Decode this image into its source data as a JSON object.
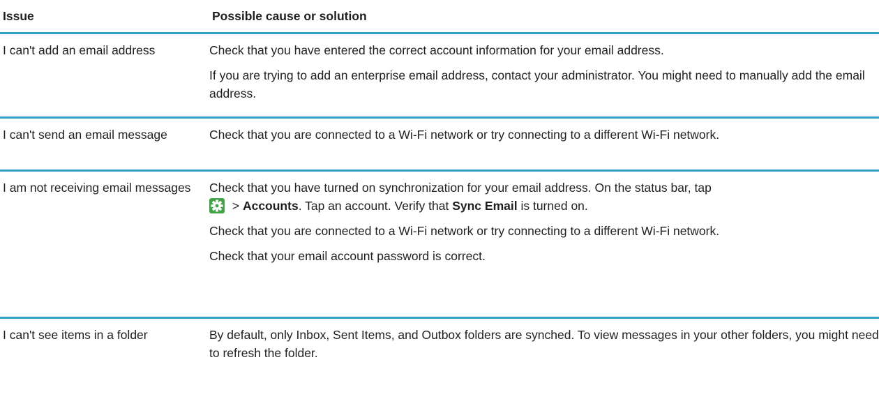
{
  "header": {
    "issue": "Issue",
    "cause": "Possible cause or solution"
  },
  "rows": [
    {
      "issue": "I can't add an email address",
      "solutions": [
        "Check that you have entered the correct account information for your email address.",
        "If you are trying to add an enterprise email address, contact your administrator. You might need to manually add the email address."
      ]
    },
    {
      "issue": "I can't send an email message",
      "solutions": [
        "Check that you are connected to a Wi-Fi network or try connecting to a different Wi-Fi network."
      ]
    },
    {
      "issue": "I am not receiving email messages",
      "solutions": [
        {
          "intro": "Check that you have turned on synchronization for your email address. On the status bar, tap",
          "sep": " > ",
          "accounts": "Accounts",
          "mid": ". Tap an account. Verify that ",
          "sync": "Sync Email",
          "end": " is turned on."
        },
        "Check that you are connected to a Wi-Fi network or try connecting to a different Wi-Fi network.",
        "Check that your email account password is correct."
      ]
    },
    {
      "issue": "I can't see items in a folder",
      "solutions": [
        "By default, only Inbox, Sent Items, and Outbox folders are synched. To view messages in your other folders, you might need to refresh the folder."
      ]
    }
  ],
  "icons": {
    "settings": "gear-icon",
    "settings_color": "#43a247",
    "rule_color": "#2e9fc9"
  }
}
